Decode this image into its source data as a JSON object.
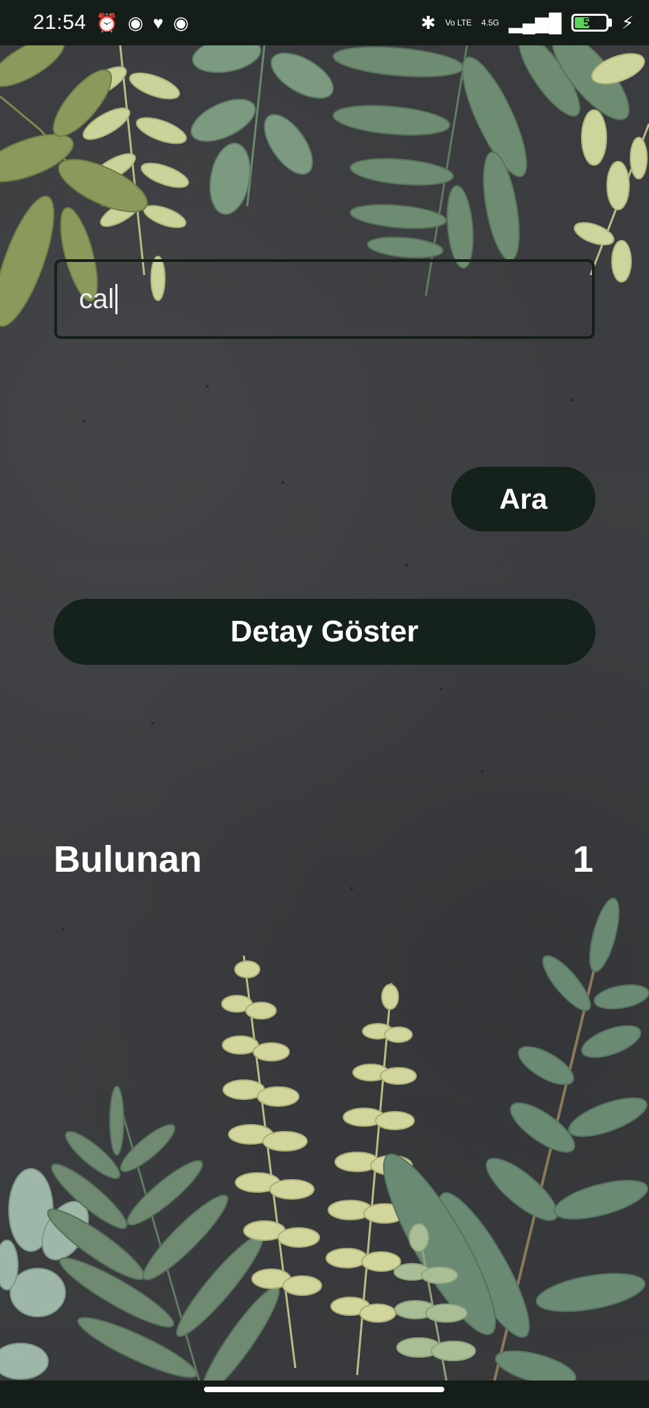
{
  "status_bar": {
    "time": "21:54",
    "network_label": "4.5G",
    "volte_label": "Vo LTE",
    "battery_level": "53",
    "battery_fraction": 0.53
  },
  "search": {
    "value": "cal"
  },
  "buttons": {
    "search_label": "Ara",
    "detail_label": "Detay Göster"
  },
  "result": {
    "label": "Bulunan",
    "count": "1"
  },
  "colors": {
    "background": "#3b3d40",
    "button_bg": "#15221b",
    "status_bar_bg": "#141d18",
    "leaf_dark": "#6f8a72",
    "leaf_light": "#cbd49a"
  },
  "icons": {
    "alarm": "alarm-clock-icon",
    "bluetooth": "bluetooth-icon",
    "signal": "signal-icon",
    "charging": "charging-bolt-icon"
  }
}
